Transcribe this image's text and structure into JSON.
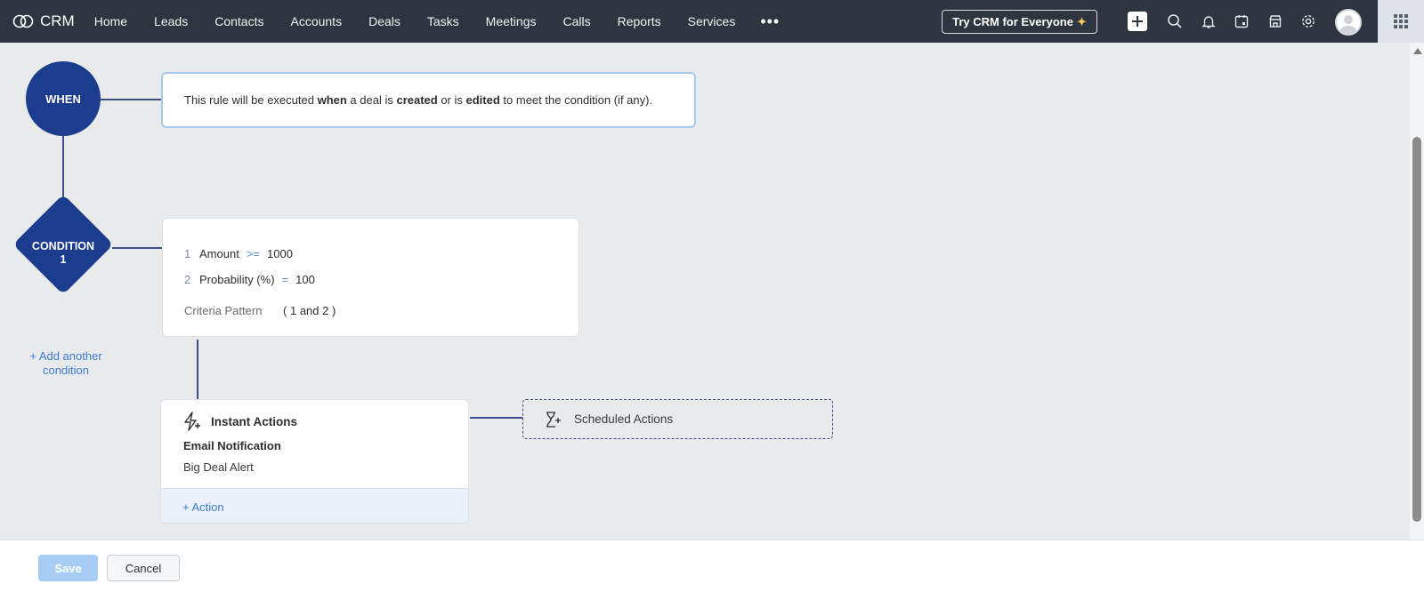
{
  "app": {
    "name": "CRM"
  },
  "nav": {
    "items": [
      "Home",
      "Leads",
      "Contacts",
      "Accounts",
      "Deals",
      "Tasks",
      "Meetings",
      "Calls",
      "Reports",
      "Services"
    ],
    "more": "•••",
    "try_button": "Try CRM for Everyone",
    "icons": [
      "plus-icon",
      "search-icon",
      "bell-icon",
      "calendar-icon",
      "store-icon",
      "gear-icon",
      "avatar",
      "apps-grid-icon"
    ]
  },
  "when": {
    "label": "WHEN",
    "text_parts": [
      "This rule will be executed ",
      "when",
      " a deal is ",
      "created",
      " or is ",
      "edited",
      " to meet the condition (if any)."
    ]
  },
  "condition": {
    "label": "CONDITION",
    "number": "1",
    "criteria": [
      {
        "num": "1",
        "field": "Amount",
        "op": ">=",
        "value": "1000"
      },
      {
        "num": "2",
        "field": "Probability (%)",
        "op": "=",
        "value": "100"
      }
    ],
    "pattern_label": "Criteria Pattern",
    "pattern_value": "( 1 and 2 )",
    "add_another": "+ Add another condition"
  },
  "instant_actions": {
    "title": "Instant Actions",
    "action_type": "Email Notification",
    "action_name": "Big Deal Alert",
    "add_action": "+ Action"
  },
  "scheduled_actions": {
    "title": "Scheduled Actions"
  },
  "footer": {
    "save": "Save",
    "cancel": "Cancel"
  },
  "colors": {
    "nav_bg": "#2e3440",
    "node_blue": "#1c3d8e",
    "connector": "#3d4f86",
    "link_blue": "#3d7bd8",
    "save_disabled": "#a8cdf5"
  }
}
